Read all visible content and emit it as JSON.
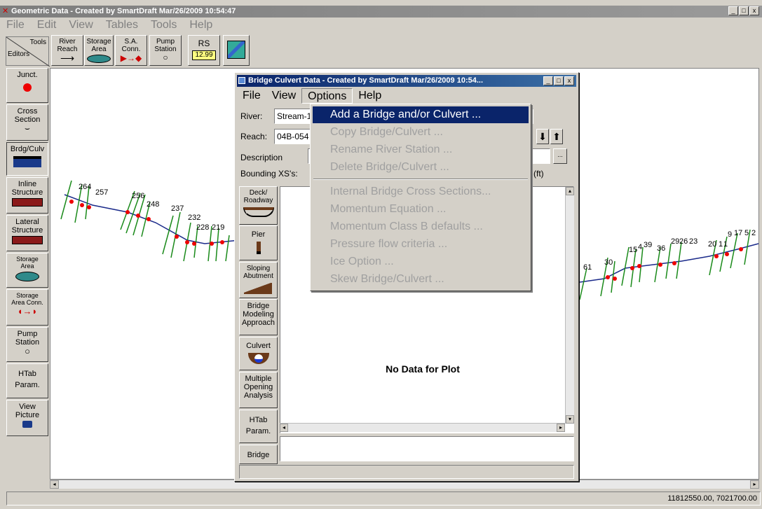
{
  "main_window": {
    "title": "Geometric Data - Created by SmartDraft Mar/26/2009 10:54:47",
    "menu": [
      "File",
      "Edit",
      "View",
      "Tables",
      "Tools",
      "Help"
    ],
    "tools_label": "Tools",
    "editors_label": "Editors",
    "toolbar": {
      "river_reach": [
        "River",
        "Reach"
      ],
      "storage_area": [
        "Storage",
        "Area"
      ],
      "sa_conn": [
        "S.A.",
        "Conn."
      ],
      "pump_station": [
        "Pump",
        "Station"
      ],
      "rs": "RS",
      "rs_value": "12.99"
    },
    "left_tools": {
      "junct": "Junct.",
      "cross_section": [
        "Cross",
        "Section"
      ],
      "brdg_culv": "Brdg/Culv",
      "inline_structure": [
        "Inline",
        "Structure"
      ],
      "lateral_structure": [
        "Lateral",
        "Structure"
      ],
      "storage_area": [
        "Storage",
        "Area"
      ],
      "storage_area_conn": [
        "Storage",
        "Area Conn."
      ],
      "pump_station": [
        "Pump",
        "Station"
      ],
      "htab_param": [
        "HTab",
        "Param."
      ],
      "view_picture": [
        "View",
        "Picture"
      ]
    },
    "status_coords": "11812550.00, 7021700.00"
  },
  "map_labels": {
    "left": [
      "264",
      "257",
      "256",
      "248",
      "237",
      "232",
      "228",
      "219"
    ],
    "right": [
      "61",
      "30",
      "15",
      "4",
      "39",
      "36",
      "29",
      "26",
      "23",
      "20",
      "1",
      "1",
      "9",
      "17",
      "5",
      "2"
    ]
  },
  "dialog": {
    "title": "Bridge Culvert Data - Created by SmartDraft Mar/26/2009 10:54...",
    "menu": [
      "File",
      "View",
      "Options",
      "Help"
    ],
    "river_label": "River:",
    "river_value": "Stream-1",
    "reach_label": "Reach:",
    "reach_value": "04B-054",
    "description_label": "Description",
    "bounding_label": "Bounding XS's:",
    "ft_label": "(ft)",
    "ellipsis": "...",
    "side_buttons": {
      "deck": [
        "Deck/",
        "Roadway"
      ],
      "pier": "Pier",
      "sloping": [
        "Sloping",
        "Abutment"
      ],
      "bridge_modeling": [
        "Bridge",
        "Modeling",
        "Approach"
      ],
      "culvert": "Culvert",
      "multiple_opening": [
        "Multiple",
        "Opening",
        "Analysis"
      ],
      "htab": [
        "HTab",
        "Param."
      ],
      "bridge": "Bridge"
    },
    "plot_message": "No Data for Plot"
  },
  "options_menu": {
    "items": [
      "Add a Bridge and/or Culvert ...",
      "Copy Bridge/Culvert ...",
      "Rename River Station ...",
      "Delete Bridge/Culvert ...",
      "Internal Bridge Cross Sections...",
      "Momentum Equation ...",
      "Momentum Class B defaults ...",
      "Pressure flow criteria ...",
      "Ice Option ...",
      "Skew Bridge/Culvert ..."
    ]
  }
}
